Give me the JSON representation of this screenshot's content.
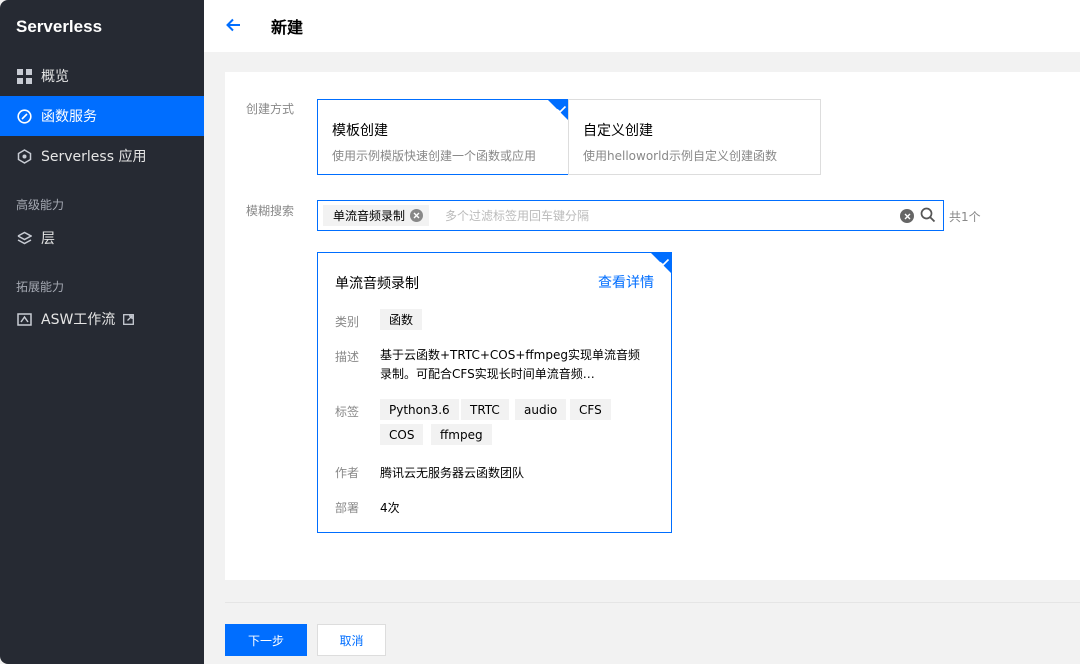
{
  "sidebar": {
    "brand": "Serverless",
    "items": [
      {
        "label": "概览",
        "icon": "grid-icon"
      },
      {
        "label": "函数服务",
        "icon": "function-icon",
        "active": true
      },
      {
        "label": "Serverless 应用",
        "icon": "app-icon"
      }
    ],
    "group_advanced": "高级能力",
    "layer_label": "层",
    "group_extended": "拓展能力",
    "asw_label": "ASW工作流"
  },
  "header": {
    "title": "新建"
  },
  "form": {
    "method_label": "创建方式",
    "methods": [
      {
        "title": "模板创建",
        "desc": "使用示例模版快速创建一个函数或应用",
        "selected": true
      },
      {
        "title": "自定义创建",
        "desc": "使用helloworld示例自定义创建函数",
        "selected": false
      }
    ],
    "search_label": "模糊搜索",
    "search_tag": "单流音频录制",
    "search_placeholder": "多个过滤标签用回车键分隔",
    "result_count": "共1个"
  },
  "template": {
    "title": "单流音频录制",
    "detail_link": "查看详情",
    "category_label": "类别",
    "category": "函数",
    "desc_label": "描述",
    "desc": "基于云函数+TRTC+COS+ffmpeg实现单流音频录制。可配合CFS实现长时间单流音频…",
    "tags_label": "标签",
    "tags": [
      "Python3.6",
      "TRTC",
      "audio",
      "CFS",
      "COS",
      "ffmpeg"
    ],
    "author_label": "作者",
    "author": "腾讯云无服务器云函数团队",
    "deploy_label": "部署",
    "deploy": "4次"
  },
  "footer": {
    "next": "下一步",
    "cancel": "取消"
  },
  "colors": {
    "primary": "#006eff",
    "sidebar_bg": "#262a33"
  }
}
